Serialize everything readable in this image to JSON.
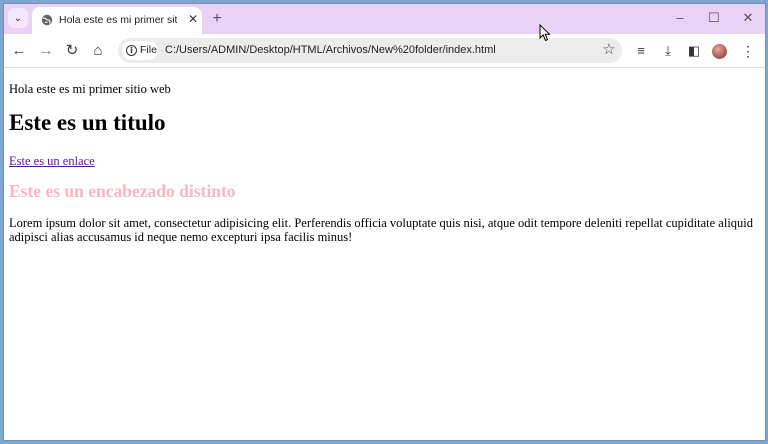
{
  "tab": {
    "search_glyph": "⌄",
    "title": "Hola este es mi primer sitio web",
    "close_glyph": "✕",
    "new_tab_glyph": "+"
  },
  "window_controls": {
    "minimize": "–",
    "maximize": "☐",
    "close": "✕"
  },
  "toolbar": {
    "back_glyph": "←",
    "forward_glyph": "→",
    "reload_glyph": "↻",
    "home_glyph": "⌂",
    "site_info_glyph": "i",
    "site_chip_label": "File",
    "url": "C:/Users/ADMIN/Desktop/HTML/Archivos/New%20folder/index.html",
    "bookmark_glyph": "☆",
    "media_glyph": "≡",
    "download_glyph": "⤓",
    "side_panel_glyph": "◧",
    "menu_glyph": "⋮"
  },
  "page": {
    "intro": "Hola este es mi primer sitio web",
    "heading": "Este es un titulo",
    "link": "Este es un enlace",
    "pink_heading": "Este es un encabezado distinto",
    "pink_color": "#f7b6c2",
    "paragraph": "Lorem ipsum dolor sit amet, consectetur adipisicing elit. Perferendis officia voluptate quis nisi, atque odit tempore deleniti repellat cupiditate aliquid adipisci alias accusamus id neque nemo excepturi ipsa facilis minus!"
  },
  "colors": {
    "tab_strip": "#e8d2f6",
    "desktop": "#7ea6cf"
  }
}
